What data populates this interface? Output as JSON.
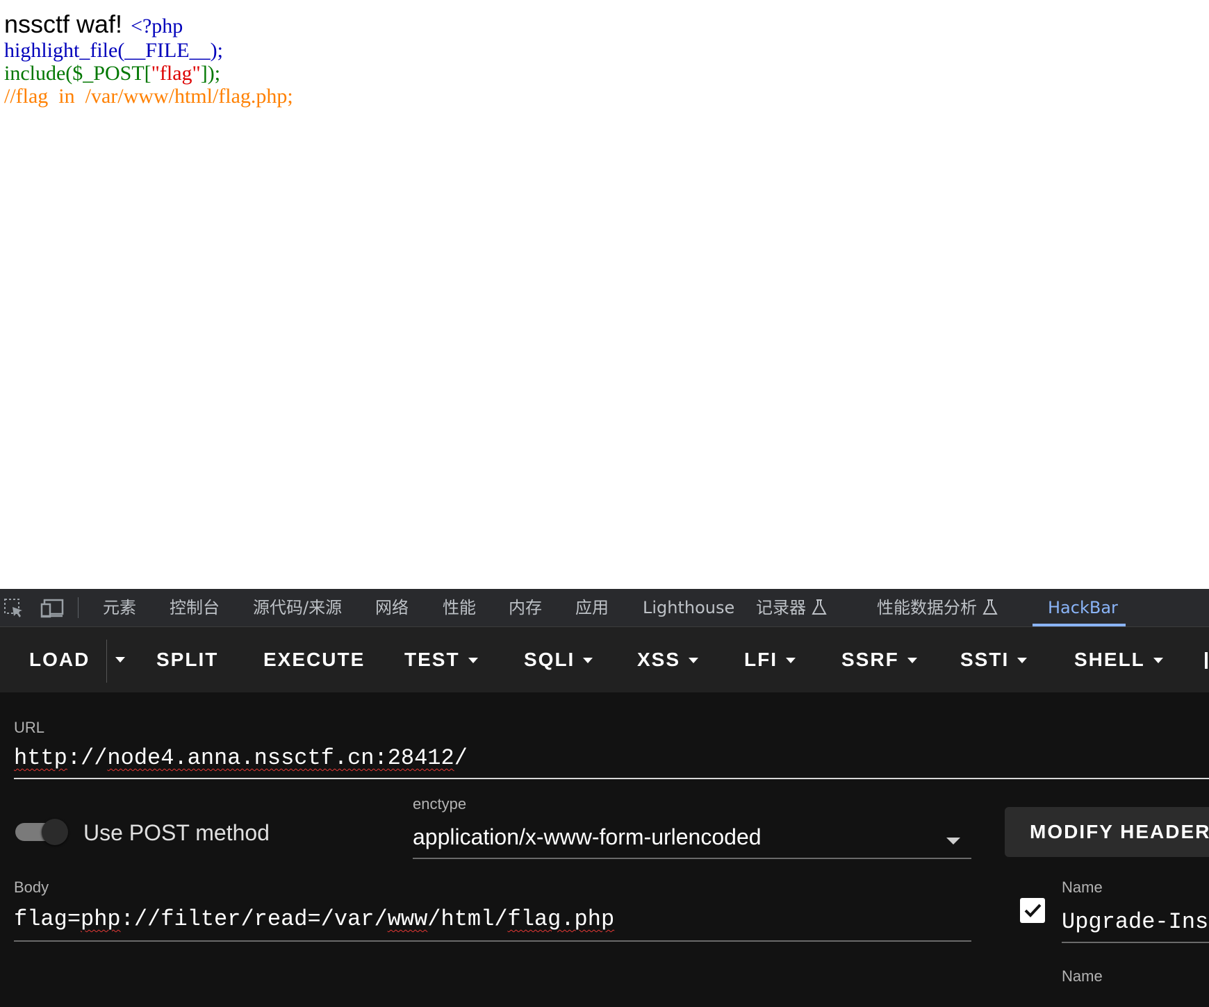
{
  "page": {
    "waf_text": "nssctf waf!",
    "php_open": "<?php",
    "code_line2": "highlight_file(__FILE__);",
    "code_line3_prefix": "include($_POST[",
    "code_line3_string": "\"flag\"",
    "code_line3_suffix": "]);",
    "code_line4": "//flag  in  /var/www/html/flag.php;"
  },
  "devtools": {
    "tabs": [
      {
        "label": "元素"
      },
      {
        "label": "控制台"
      },
      {
        "label": "源代码/来源"
      },
      {
        "label": "网络"
      },
      {
        "label": "性能"
      },
      {
        "label": "内存"
      },
      {
        "label": "应用"
      },
      {
        "label": "Lighthouse"
      },
      {
        "label": "记录器"
      },
      {
        "label": "性能数据分析"
      },
      {
        "label": "HackBar"
      }
    ],
    "active_tab": "HackBar"
  },
  "hackbar": {
    "toolbar": {
      "load": "LOAD",
      "split": "SPLIT",
      "execute": "EXECUTE",
      "test": "TEST",
      "sqli": "SQLI",
      "xss": "XSS",
      "lfi": "LFI",
      "ssrf": "SSRF",
      "ssti": "SSTI",
      "shell": "SHELL"
    },
    "url": {
      "label": "URL",
      "value_a": "http",
      "value_b": "://",
      "value_c": "node4.anna.nssctf.cn:28412",
      "value_d": "/"
    },
    "post": {
      "label": "Use POST method",
      "enabled": true
    },
    "enctype": {
      "label": "enctype",
      "value": "application/x-www-form-urlencoded"
    },
    "modify_header": "MODIFY HEADER",
    "body": {
      "label": "Body",
      "v1": "flag=",
      "v2": "php",
      "v3": "://filter/read=/var/",
      "v4": "www",
      "v5": "/html/",
      "v6": "flag.php"
    },
    "headers": {
      "name_label": "Name",
      "first_value": "Upgrade-Ins",
      "first_checked": true,
      "second_name_label": "Name"
    }
  },
  "colors": {
    "php_default": "#0000bb",
    "php_keyword": "#007700",
    "php_string": "#dd0000",
    "php_comment": "#ff8000",
    "devtools_accent": "#8ab4f8"
  }
}
